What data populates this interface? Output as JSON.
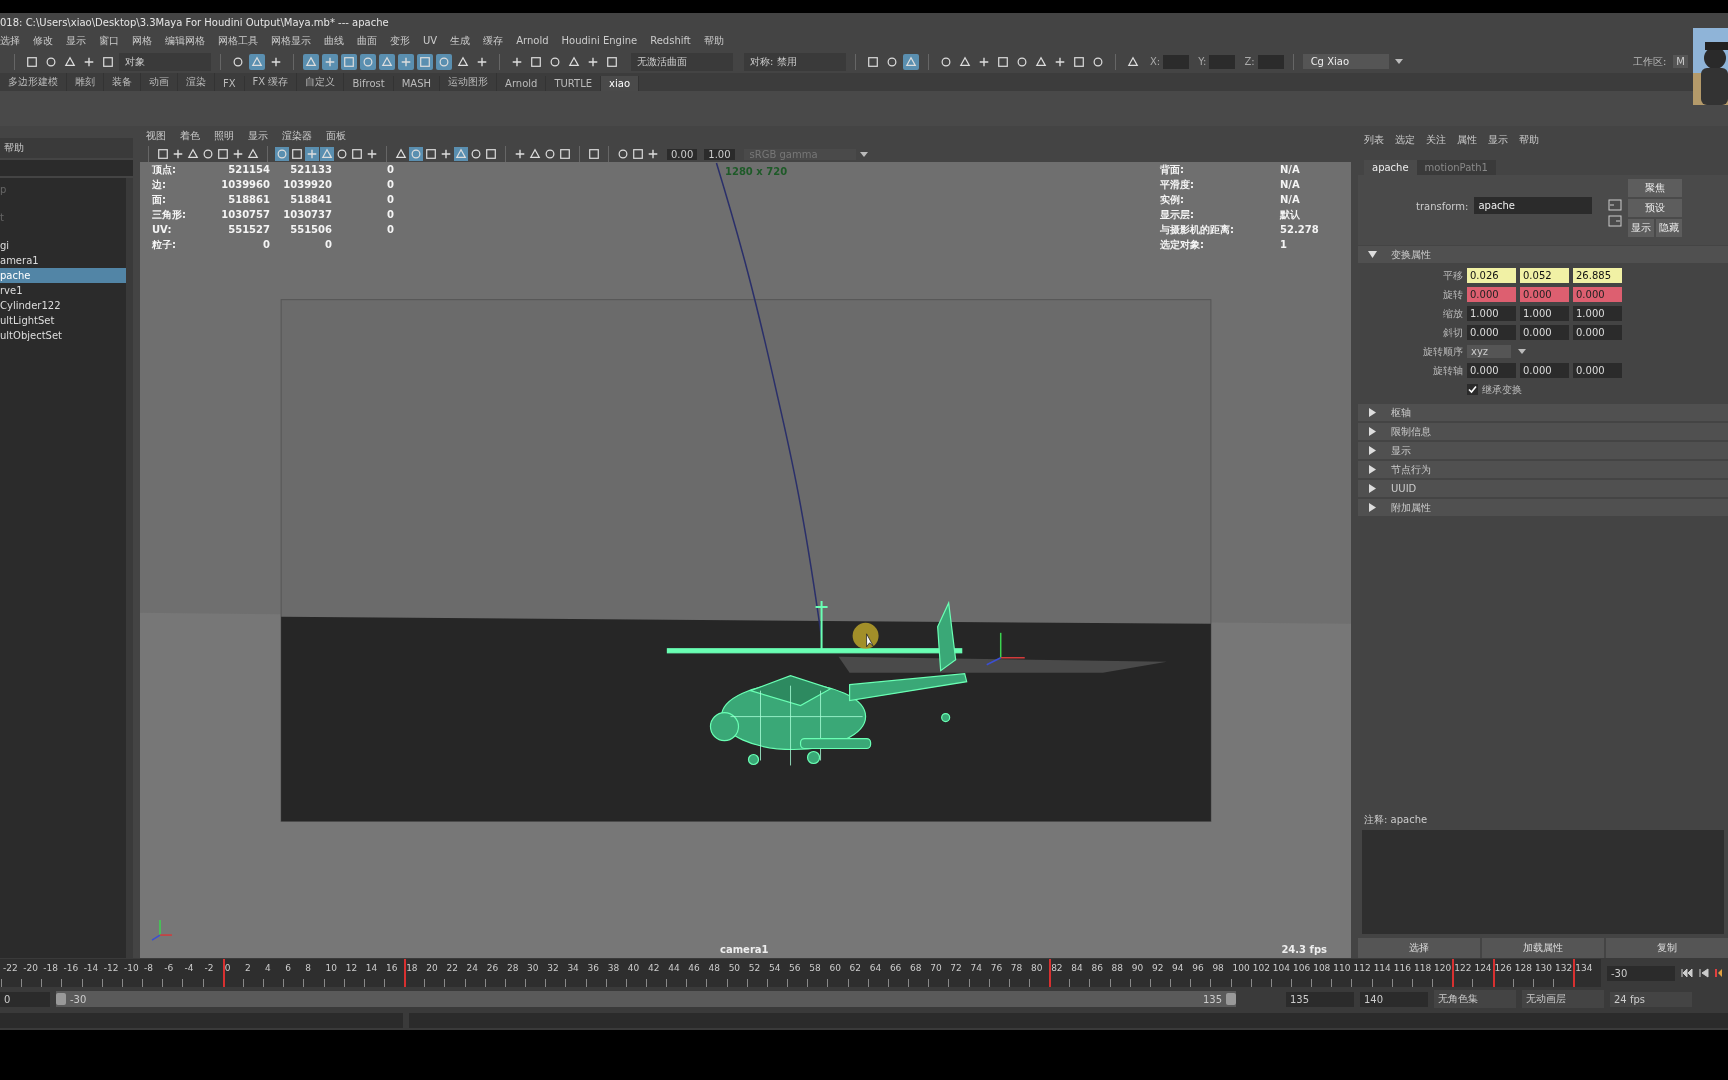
{
  "title_bar": {
    "title": "018: C:\\Users\\xiao\\Desktop\\3.3Maya For Houdini  Output\\Maya.mb*   ---   apache"
  },
  "menu_bar": {
    "items": [
      "选择",
      "修改",
      "显示",
      "窗口",
      "网格",
      "编辑网格",
      "网格工具",
      "网格显示",
      "曲线",
      "曲面",
      "变形",
      "UV",
      "生成",
      "缓存",
      "Arnold",
      "Houdini Engine",
      "Redshift",
      "帮助"
    ]
  },
  "toolbar": {
    "mode": "对象",
    "surface": "无激活曲面",
    "symmetry": "对称: 禁用",
    "coords": [
      "X:",
      "Y:",
      "Z:"
    ],
    "account": "Cg Xiao",
    "workspace_label": "工作区:",
    "workspace": "M",
    "groups": [
      [
        {
          "on": false
        },
        {
          "on": false
        },
        {
          "on": false
        },
        {
          "on": false
        },
        {
          "on": false
        }
      ],
      [
        {
          "on": false
        },
        {
          "on": true
        },
        {
          "on": false
        }
      ],
      [
        {
          "on": true
        },
        {
          "on": true
        },
        {
          "on": true
        },
        {
          "on": true
        },
        {
          "on": true
        },
        {
          "on": true
        },
        {
          "on": true
        },
        {
          "on": true
        },
        {
          "on": false
        },
        {
          "on": false
        }
      ],
      [
        {
          "on": false
        },
        {
          "on": false
        },
        {
          "on": false
        },
        {
          "on": false
        },
        {
          "on": false
        },
        {
          "on": false
        }
      ],
      [
        {
          "on": false
        },
        {
          "on": false
        },
        {
          "on": true
        }
      ],
      [
        {
          "on": false
        },
        {
          "on": false
        },
        {
          "on": false
        },
        {
          "on": false
        },
        {
          "on": false
        },
        {
          "on": false
        },
        {
          "on": false
        },
        {
          "on": false
        },
        {
          "on": false
        }
      ],
      [
        {
          "on": false
        }
      ]
    ]
  },
  "shelf_tabs": [
    {
      "label": "多边形建模",
      "selected": false
    },
    {
      "label": "雕刻",
      "selected": false
    },
    {
      "label": "装备",
      "selected": false
    },
    {
      "label": "动画",
      "selected": false
    },
    {
      "label": "渲染",
      "selected": false
    },
    {
      "label": "FX",
      "selected": false
    },
    {
      "label": "FX 缓存",
      "selected": false
    },
    {
      "label": "自定义",
      "selected": false
    },
    {
      "label": "Bifrost",
      "selected": false
    },
    {
      "label": "MASH",
      "selected": false
    },
    {
      "label": "运动图形",
      "selected": false
    },
    {
      "label": "Arnold",
      "selected": false
    },
    {
      "label": "TURTLE",
      "selected": false
    },
    {
      "label": "xiao",
      "selected": true
    }
  ],
  "outliner": {
    "menu": "帮助",
    "items": [
      {
        "label": "p",
        "selected": false,
        "dimmed": true
      },
      {
        "label": "t",
        "selected": false,
        "dimmed": true
      },
      {
        "label": "gi",
        "selected": false,
        "dimmed": false
      },
      {
        "label": "amera1",
        "selected": false,
        "dimmed": false
      },
      {
        "label": "pache",
        "selected": true,
        "dimmed": false
      },
      {
        "label": "rve1",
        "selected": false,
        "dimmed": false
      },
      {
        "label": "Cylinder122",
        "selected": false,
        "dimmed": false
      },
      {
        "label": "ultLightSet",
        "selected": false,
        "dimmed": false
      },
      {
        "label": "ultObjectSet",
        "selected": false,
        "dimmed": false
      }
    ]
  },
  "viewport": {
    "menus": [
      "视图",
      "着色",
      "照明",
      "显示",
      "渲染器",
      "面板"
    ],
    "icon_groups": [
      [
        {
          "on": false
        },
        {
          "on": false
        },
        {
          "on": false
        },
        {
          "on": false
        },
        {
          "on": false
        },
        {
          "on": false
        },
        {
          "on": false
        }
      ],
      [
        {
          "on": true
        },
        {
          "on": false
        },
        {
          "on": true
        },
        {
          "on": true
        },
        {
          "on": false
        },
        {
          "on": false
        },
        {
          "on": false
        }
      ],
      [
        {
          "on": false
        },
        {
          "on": true
        },
        {
          "on": false
        },
        {
          "on": false
        },
        {
          "on": true
        },
        {
          "on": false
        },
        {
          "on": false
        }
      ],
      [
        {
          "on": false
        },
        {
          "on": false
        },
        {
          "on": false
        },
        {
          "on": false
        }
      ],
      [
        {
          "on": false
        }
      ],
      [
        {
          "on": false
        },
        {
          "on": false
        },
        {
          "on": false
        }
      ]
    ],
    "exposure": "0.00",
    "gamma": "1.00",
    "color_space": "sRGB gamma",
    "resolution": "1280 x 720",
    "hud_left": [
      {
        "label": "顶点:",
        "values": [
          "521154",
          "521133",
          "0"
        ]
      },
      {
        "label": "边:",
        "values": [
          "1039960",
          "1039920",
          "0"
        ]
      },
      {
        "label": "面:",
        "values": [
          "518861",
          "518841",
          "0"
        ]
      },
      {
        "label": "三角形:",
        "values": [
          "1030757",
          "1030737",
          "0"
        ]
      },
      {
        "label": "UV:",
        "values": [
          "551527",
          "551506",
          "0"
        ]
      },
      {
        "label": "粒子:",
        "values": [
          "0",
          "0"
        ]
      }
    ],
    "hud_right": [
      {
        "label": "背面:",
        "value": "N/A"
      },
      {
        "label": "平滑度:",
        "value": "N/A"
      },
      {
        "label": "实例:",
        "value": "N/A"
      },
      {
        "label": "显示层:",
        "value": "默认"
      },
      {
        "label": "与摄影机的距离:",
        "value": "52.278"
      },
      {
        "label": "选定对象:",
        "value": "1"
      }
    ],
    "camera": "camera1",
    "fps": "24.3 fps"
  },
  "attribute_editor": {
    "menus": [
      "列表",
      "选定",
      "关注",
      "属性",
      "显示",
      "帮助"
    ],
    "tabs": [
      {
        "label": "apache",
        "selected": true
      },
      {
        "label": "motionPath1",
        "selected": false
      }
    ],
    "node_type": "transform:",
    "node_name": "apache",
    "buttons": [
      "聚焦",
      "预设",
      "显示",
      "隐藏"
    ],
    "sections": [
      {
        "title": "变换属性",
        "expanded": true,
        "rows": [
          {
            "kind": "vector",
            "label": "平移",
            "connected": true,
            "keyed": false,
            "values": [
              "0.026",
              "0.052",
              "26.885"
            ]
          },
          {
            "kind": "vector",
            "label": "旋转",
            "connected": false,
            "keyed": true,
            "values": [
              "0.000",
              "0.000",
              "0.000"
            ]
          },
          {
            "kind": "vector",
            "label": "缩放",
            "connected": false,
            "keyed": false,
            "values": [
              "1.000",
              "1.000",
              "1.000"
            ]
          },
          {
            "kind": "vector",
            "label": "斜切",
            "connected": false,
            "keyed": false,
            "values": [
              "0.000",
              "0.000",
              "0.000"
            ]
          },
          {
            "kind": "dropdown",
            "label": "旋转顺序",
            "value": "xyz"
          },
          {
            "kind": "vector",
            "label": "旋转轴",
            "connected": false,
            "keyed": false,
            "values": [
              "0.000",
              "0.000",
              "0.000"
            ]
          },
          {
            "kind": "checkbox",
            "label": "继承变换",
            "checked": true
          }
        ]
      },
      {
        "title": "枢轴",
        "expanded": false
      },
      {
        "title": "限制信息",
        "expanded": false
      },
      {
        "title": "显示",
        "expanded": false
      },
      {
        "title": "节点行为",
        "expanded": false
      },
      {
        "title": "UUID",
        "expanded": false
      },
      {
        "title": "附加属性",
        "expanded": false
      }
    ],
    "notes": "注释:  apache",
    "bottom_buttons": [
      "选择",
      "加载属性",
      "复制"
    ]
  },
  "timeline": {
    "current_frame": "-30",
    "ticks": [
      {
        "label": "-22",
        "keyed": false
      },
      {
        "label": "-20",
        "keyed": false
      },
      {
        "label": "-18",
        "keyed": false
      },
      {
        "label": "-16",
        "keyed": false
      },
      {
        "label": "-14",
        "keyed": false
      },
      {
        "label": "-12",
        "keyed": false
      },
      {
        "label": "-10",
        "keyed": false
      },
      {
        "label": "-8",
        "keyed": false
      },
      {
        "label": "-6",
        "keyed": false
      },
      {
        "label": "-4",
        "keyed": false
      },
      {
        "label": "-2",
        "keyed": false
      },
      {
        "label": "0",
        "keyed": true
      },
      {
        "label": "2",
        "keyed": false
      },
      {
        "label": "4",
        "keyed": false
      },
      {
        "label": "6",
        "keyed": false
      },
      {
        "label": "8",
        "keyed": false
      },
      {
        "label": "10",
        "keyed": false
      },
      {
        "label": "12",
        "keyed": false
      },
      {
        "label": "14",
        "keyed": false
      },
      {
        "label": "16",
        "keyed": false
      },
      {
        "label": "18",
        "keyed": true
      },
      {
        "label": "20",
        "keyed": false
      },
      {
        "label": "22",
        "keyed": false
      },
      {
        "label": "24",
        "keyed": false
      },
      {
        "label": "26",
        "keyed": false
      },
      {
        "label": "28",
        "keyed": false
      },
      {
        "label": "30",
        "keyed": false
      },
      {
        "label": "32",
        "keyed": false
      },
      {
        "label": "34",
        "keyed": false
      },
      {
        "label": "36",
        "keyed": false
      },
      {
        "label": "38",
        "keyed": false
      },
      {
        "label": "40",
        "keyed": false
      },
      {
        "label": "42",
        "keyed": false
      },
      {
        "label": "44",
        "keyed": false
      },
      {
        "label": "46",
        "keyed": false
      },
      {
        "label": "48",
        "keyed": false
      },
      {
        "label": "50",
        "keyed": false
      },
      {
        "label": "52",
        "keyed": false
      },
      {
        "label": "54",
        "keyed": false
      },
      {
        "label": "56",
        "keyed": false
      },
      {
        "label": "58",
        "keyed": false
      },
      {
        "label": "60",
        "keyed": false
      },
      {
        "label": "62",
        "keyed": false
      },
      {
        "label": "64",
        "keyed": false
      },
      {
        "label": "66",
        "keyed": false
      },
      {
        "label": "68",
        "keyed": false
      },
      {
        "label": "70",
        "keyed": false
      },
      {
        "label": "72",
        "keyed": false
      },
      {
        "label": "74",
        "keyed": false
      },
      {
        "label": "76",
        "keyed": false
      },
      {
        "label": "78",
        "keyed": false
      },
      {
        "label": "80",
        "keyed": false
      },
      {
        "label": "82",
        "keyed": true
      },
      {
        "label": "84",
        "keyed": false
      },
      {
        "label": "86",
        "keyed": false
      },
      {
        "label": "88",
        "keyed": false
      },
      {
        "label": "90",
        "keyed": false
      },
      {
        "label": "92",
        "keyed": false
      },
      {
        "label": "94",
        "keyed": false
      },
      {
        "label": "96",
        "keyed": false
      },
      {
        "label": "98",
        "keyed": false
      },
      {
        "label": "100",
        "keyed": false
      },
      {
        "label": "102",
        "keyed": false
      },
      {
        "label": "104",
        "keyed": false
      },
      {
        "label": "106",
        "keyed": false
      },
      {
        "label": "108",
        "keyed": false
      },
      {
        "label": "110",
        "keyed": false
      },
      {
        "label": "112",
        "keyed": false
      },
      {
        "label": "114",
        "keyed": false
      },
      {
        "label": "116",
        "keyed": false
      },
      {
        "label": "118",
        "keyed": false
      },
      {
        "label": "120",
        "keyed": false
      },
      {
        "label": "122",
        "keyed": true
      },
      {
        "label": "124",
        "keyed": false
      },
      {
        "label": "126",
        "keyed": true
      },
      {
        "label": "128",
        "keyed": false
      },
      {
        "label": "130",
        "keyed": false
      },
      {
        "label": "132",
        "keyed": false
      },
      {
        "label": "134",
        "keyed": true
      }
    ]
  },
  "range": {
    "level": 1,
    "start": "0",
    "range_start": "-30",
    "range_end": "135",
    "end": "135",
    "anim_end": "140",
    "character_set": "无角色集",
    "anim_layer": "无动画层",
    "fps": "24 fps"
  }
}
